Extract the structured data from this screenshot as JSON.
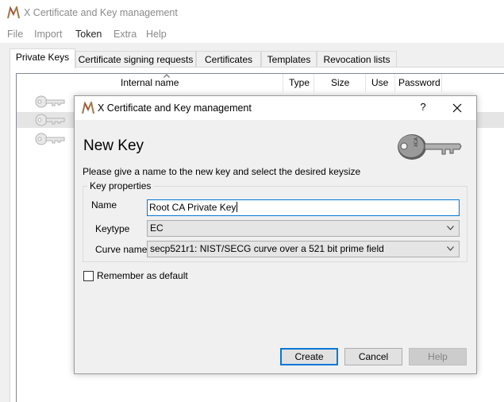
{
  "window": {
    "title": "X Certificate and Key management"
  },
  "menu": [
    {
      "label": "File"
    },
    {
      "label": "Import"
    },
    {
      "label": "Token"
    },
    {
      "label": "Extra"
    },
    {
      "label": "Help"
    }
  ],
  "tabs": [
    {
      "label": "Private Keys",
      "active": true
    },
    {
      "label": "Certificate signing requests"
    },
    {
      "label": "Certificates"
    },
    {
      "label": "Templates"
    },
    {
      "label": "Revocation lists"
    }
  ],
  "list": {
    "columns": [
      "Internal name",
      "Type",
      "Size",
      "Use",
      "Password"
    ],
    "row_count": 3,
    "selected_row": 2
  },
  "dialog": {
    "title": "X Certificate and Key management",
    "help_label": "?",
    "heading": "New Key",
    "description": "Please give a name to the new key and select the desired keysize",
    "group_title": "Key properties",
    "name_label": "Name",
    "name_value": "Root CA Private Key",
    "keytype_label": "Keytype",
    "keytype_value": "EC",
    "curve_label": "Curve name",
    "curve_value": "secp521r1: NIST/SECG curve over a 521 bit prime field",
    "remember_label": "Remember as default",
    "remember_checked": false,
    "buttons": {
      "create": "Create",
      "cancel": "Cancel",
      "help": "Help"
    }
  },
  "icons": {
    "app": "xca-app-icon",
    "key": "key-icon",
    "close": "close-icon",
    "dropdown": "chevron-down-icon"
  },
  "colors": {
    "accent": "#0078d7",
    "selection": "#e5e5e5",
    "disabled_text": "#838383"
  }
}
